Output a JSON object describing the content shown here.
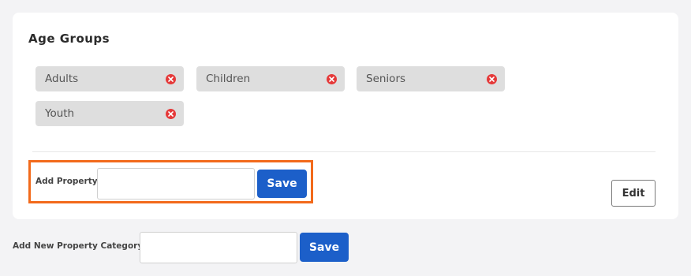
{
  "section": {
    "title": "Age Groups",
    "tags": [
      {
        "label": "Adults",
        "remove_icon": "x-circle-icon"
      },
      {
        "label": "Children",
        "remove_icon": "x-circle-icon"
      },
      {
        "label": "Seniors",
        "remove_icon": "x-circle-icon"
      },
      {
        "label": "Youth",
        "remove_icon": "x-circle-icon"
      }
    ],
    "add_property": {
      "label": "Add Property",
      "value": "",
      "save_label": "Save"
    },
    "edit_label": "Edit"
  },
  "add_category": {
    "label": "Add New Property Category",
    "value": "",
    "save_label": "Save"
  },
  "colors": {
    "primary": "#1c5fc9",
    "highlight": "#f26a1b",
    "remove": "#e53939",
    "tag_bg": "#dedede"
  }
}
